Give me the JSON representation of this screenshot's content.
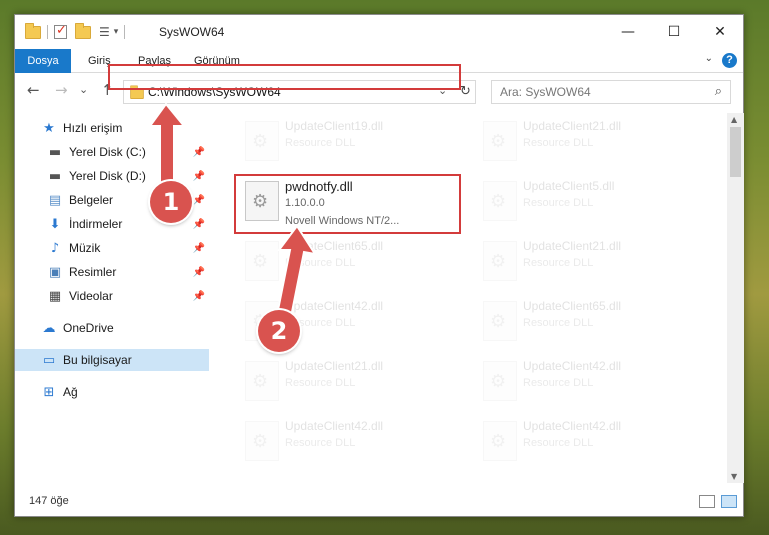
{
  "window": {
    "title": "SysWOW64",
    "buttons": {
      "minimize": "—",
      "maximize": "☐",
      "close": "✕"
    }
  },
  "ribbon": {
    "tabs": [
      "Dosya",
      "Giriş",
      "Paylaş",
      "Görünüm"
    ]
  },
  "nav": {
    "back": "←",
    "forward": "→",
    "recent": "⌄",
    "up": "↑",
    "address": "C:\\Windows\\SysWOW64",
    "refresh": "↻",
    "dropdown": "⌄",
    "search_placeholder": "Ara: SysWOW64",
    "search_icon": "⌕"
  },
  "sidebar": {
    "items": [
      {
        "label": "Hızlı erişim",
        "icon": "star-icon",
        "pinned": false
      },
      {
        "label": "Yerel Disk (C:)",
        "icon": "drive-icon",
        "pinned": true
      },
      {
        "label": "Yerel Disk (D:)",
        "icon": "drive-icon",
        "pinned": true
      },
      {
        "label": "Belgeler",
        "icon": "documents-icon",
        "pinned": true
      },
      {
        "label": "İndirmeler",
        "icon": "downloads-icon",
        "pinned": true
      },
      {
        "label": "Müzik",
        "icon": "music-icon",
        "pinned": true
      },
      {
        "label": "Resimler",
        "icon": "pictures-icon",
        "pinned": true
      },
      {
        "label": "Videolar",
        "icon": "videos-icon",
        "pinned": true
      },
      {
        "label": "OneDrive",
        "icon": "cloud-icon",
        "pinned": false
      },
      {
        "label": "Bu bilgisayar",
        "icon": "computer-icon",
        "pinned": false
      },
      {
        "label": "Ağ",
        "icon": "network-icon",
        "pinned": false
      }
    ]
  },
  "files": {
    "highlighted": {
      "name": "pwdnotfy.dll",
      "version": "1.10.0.0",
      "company": "Novell Windows NT/2..."
    },
    "left_column": [
      {
        "name": "UpdateClient19.dll",
        "desc": "Resource DLL"
      },
      {
        "name": "UpdateClient65.dll",
        "desc": "Resource DLL"
      },
      {
        "name": "UpdateClient42.dll",
        "desc": "Resource DLL"
      },
      {
        "name": "UpdateClient21.dll",
        "desc": "Resource DLL"
      },
      {
        "name": "UpdateClient42.dll",
        "desc": "Resource DLL"
      }
    ],
    "right_column": [
      {
        "name": "UpdateClient21.dll",
        "desc": "Resource DLL"
      },
      {
        "name": "UpdateClient5.dll",
        "desc": "Resource DLL"
      },
      {
        "name": "UpdateClient21.dll",
        "desc": "Resource DLL"
      },
      {
        "name": "UpdateClient65.dll",
        "desc": "Resource DLL"
      },
      {
        "name": "UpdateClient42.dll",
        "desc": "Resource DLL"
      },
      {
        "name": "UpdateClient42.dll",
        "desc": "Resource DLL"
      }
    ]
  },
  "status": {
    "count": "147 öğe"
  },
  "annotations": {
    "step1": "1",
    "step2": "2"
  },
  "colors": {
    "accent": "#1979ca",
    "highlight": "#d33b3b",
    "selected": "#cce4f7"
  }
}
